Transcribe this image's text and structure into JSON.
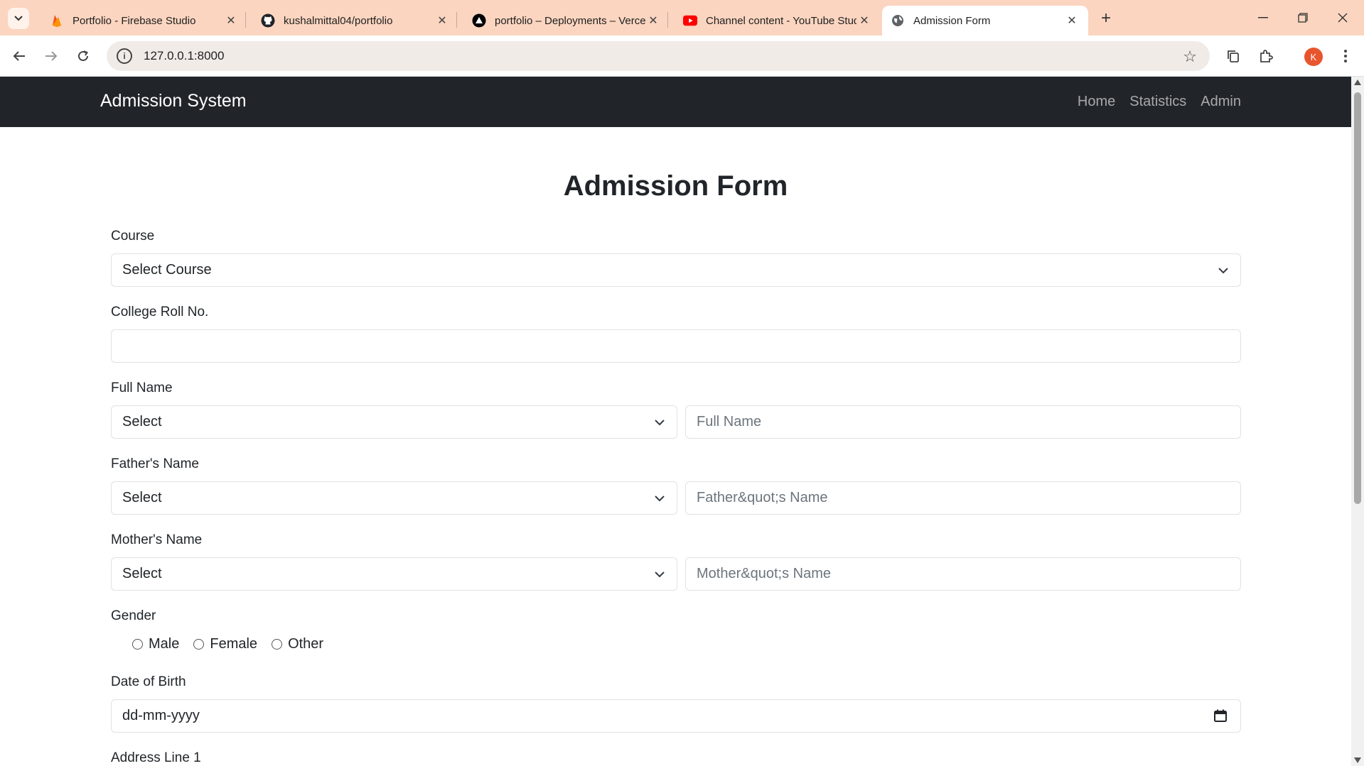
{
  "browser": {
    "tabs": [
      {
        "title": "Portfolio - Firebase Studio",
        "icon": "firebase-icon",
        "active": false
      },
      {
        "title": "kushalmittal04/portfolio",
        "icon": "github-icon",
        "active": false
      },
      {
        "title": "portfolio – Deployments – Vercel",
        "icon": "vercel-icon",
        "active": false
      },
      {
        "title": "Channel content - YouTube Studio",
        "icon": "youtube-icon",
        "active": false
      },
      {
        "title": "Admission Form",
        "icon": "globe-icon",
        "active": true
      }
    ],
    "url": "127.0.0.1:8000",
    "profile_initial": "K",
    "accent": "#fbd5c0"
  },
  "navbar": {
    "brand": "Admission System",
    "links": [
      "Home",
      "Statistics",
      "Admin"
    ]
  },
  "form": {
    "title": "Admission Form",
    "course": {
      "label": "Course",
      "selected": "Select Course"
    },
    "roll": {
      "label": "College Roll No.",
      "value": ""
    },
    "full_name": {
      "label": "Full Name",
      "select": "Select",
      "placeholder": "Full Name"
    },
    "father_name": {
      "label": "Father's Name",
      "select": "Select",
      "placeholder": "Father&quot;s Name"
    },
    "mother_name": {
      "label": "Mother's Name",
      "select": "Select",
      "placeholder": "Mother&quot;s Name"
    },
    "gender": {
      "label": "Gender",
      "options": [
        "Male",
        "Female",
        "Other"
      ]
    },
    "dob": {
      "label": "Date of Birth",
      "placeholder": "dd-mm-yyyy"
    },
    "address1": {
      "label": "Address Line 1"
    }
  }
}
